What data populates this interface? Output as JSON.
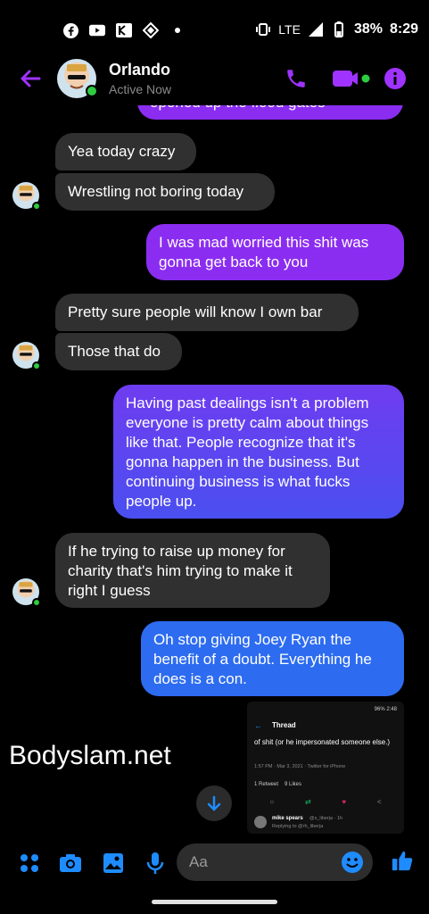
{
  "status_bar": {
    "notification_icons": [
      "facebook-icon",
      "youtube-icon",
      "kinemaster-icon",
      "diamond-icon",
      "dot-icon"
    ],
    "network": "LTE",
    "battery": "38%",
    "time": "8:29"
  },
  "header": {
    "contact_name": "Orlando",
    "contact_status": "Active Now"
  },
  "messages": [
    {
      "from": "me",
      "text": "opened up the flood gates"
    },
    {
      "from": "them",
      "text": "Yea today crazy"
    },
    {
      "from": "them",
      "text": "Wrestling not boring today"
    },
    {
      "from": "me",
      "text": "I was mad worried this shit was gonna get back to you"
    },
    {
      "from": "them",
      "text": "Pretty sure people will know I own bar"
    },
    {
      "from": "them",
      "text": "Those that do"
    },
    {
      "from": "me",
      "text": "Having past dealings isn't a problem everyone is pretty calm about things like that. People recognize that it's gonna happen in the business. But continuing business is what fucks people up."
    },
    {
      "from": "them",
      "text": "If he trying to raise up money for charity that's him trying to make it right I guess"
    },
    {
      "from": "me",
      "text": "Oh stop giving Joey Ryan the benefit of a doubt. Everything he does is a con."
    }
  ],
  "shared_screenshot": {
    "status": "96% 2:48",
    "title": "Thread",
    "body": "of shit (or he impersonated someone else.)",
    "meta": "1:57 PM · Mar 3, 2021 · Twitter for iPhone",
    "retweets": "1 Retweet",
    "likes": "9 Likes",
    "reply_user": "mike spears",
    "reply_handle": "@s_liberja · 1h",
    "replying_to": "Replying to @rh_liberja"
  },
  "watermark": "Bodyslam.net",
  "composer": {
    "placeholder": "Aa"
  },
  "colors": {
    "accent_purple": "#a033ff",
    "sent_purple": "#8b2df0",
    "sent_violet": "#6a3df0",
    "sent_blue": "#2d6cf0",
    "received": "#303030",
    "online": "#2ecc40",
    "composer_blue": "#1e8cff"
  }
}
